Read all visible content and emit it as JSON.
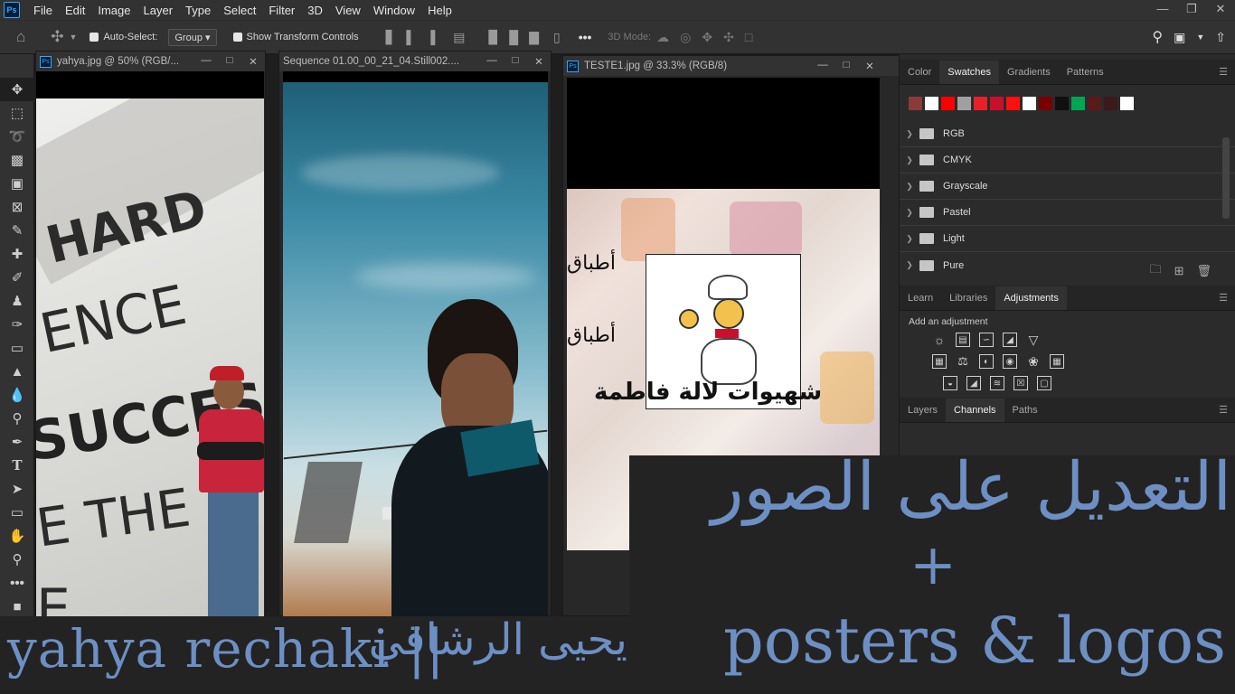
{
  "menu": {
    "logo": "Ps",
    "items": [
      "File",
      "Edit",
      "Image",
      "Layer",
      "Type",
      "Select",
      "Filter",
      "3D",
      "View",
      "Window",
      "Help"
    ]
  },
  "options": {
    "auto_select_label": "Auto-Select:",
    "auto_select_value": "Group",
    "transform_label": "Show Transform Controls",
    "mode_3d_label": "3D Mode:"
  },
  "documents": [
    {
      "title": "yahya.jpg @ 50% (RGB/...",
      "image_text": [
        "HARD",
        "ENCE",
        "SUCCESS",
        "E THE",
        "E"
      ]
    },
    {
      "title": "Sequence 01.00_00_21_04.Still002...."
    },
    {
      "title": "TESTE1.jpg @ 33.3% (RGB/8)",
      "image_text": [
        "أطباق",
        "أطباق",
        "شهيوات لالة فاطمة"
      ]
    }
  ],
  "panels": {
    "top_tabs": [
      "Color",
      "Swatches",
      "Gradients",
      "Patterns"
    ],
    "top_active": "Swatches",
    "swatch_colors": [
      "#8b3a3a",
      "#ffffff",
      "#ff0000",
      "#a0a0a0",
      "#e8202a",
      "#c8102e",
      "#ff1010",
      "#ffffff",
      "#7a0000",
      "#101010",
      "#00a651",
      "#5a1a1a",
      "#3a1a1a",
      "#ffffff"
    ],
    "swatch_groups": [
      "RGB",
      "CMYK",
      "Grayscale",
      "Pastel",
      "Light",
      "Pure"
    ],
    "mid_tabs": [
      "Learn",
      "Libraries",
      "Adjustments"
    ],
    "mid_active": "Adjustments",
    "adjust_hint": "Add an adjustment",
    "bottom_tabs": [
      "Layers",
      "Channels",
      "Paths"
    ],
    "bottom_active": "Channels"
  },
  "overlay": {
    "arabic_title": "التعديل على الصور",
    "plus": "+",
    "english_title": "posters & logos",
    "author_latin": "yahya rechaki ||",
    "author_arabic": "يحيى الرشاقي"
  }
}
